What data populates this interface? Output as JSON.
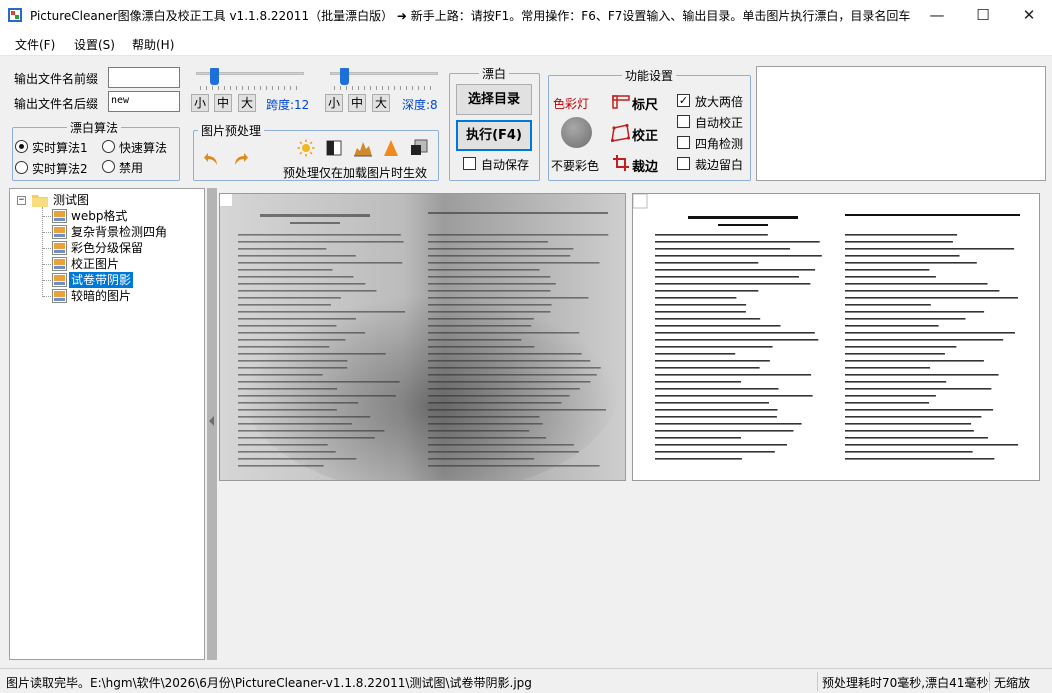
{
  "window": {
    "title": "PictureCleaner图像漂白及校正工具 v1.1.8.22011（批量漂白版）  ➜ 新手上路：请按F1。常用操作：F6、F7设置输入、输出目录。单击图片执行漂白，目录名回车...",
    "minimize": "—",
    "maximize": "☐",
    "close": "✕"
  },
  "menu": {
    "items": [
      "文件(F)",
      "设置(S)",
      "帮助(H)"
    ]
  },
  "output": {
    "prefix_label": "输出文件名前缀",
    "prefix_value": "",
    "suffix_label": "输出文件名后缀",
    "suffix_value": "new"
  },
  "span_slider": {
    "sizes": [
      "小",
      "中",
      "大"
    ],
    "value_text": "跨度:12",
    "level": 0.12
  },
  "depth_slider": {
    "sizes": [
      "小",
      "中",
      "大"
    ],
    "value_text": "深度:8",
    "level": 0.08
  },
  "algorithm": {
    "title": "漂白算法",
    "options": [
      {
        "label": "实时算法1",
        "selected": true
      },
      {
        "label": "快速算法",
        "selected": false
      },
      {
        "label": "实时算法2",
        "selected": false
      },
      {
        "label": "禁用",
        "selected": false
      }
    ]
  },
  "preprocess": {
    "title": "图片预处理",
    "note": "预处理仅在加载图片时生效",
    "icons": [
      "undo-icon",
      "redo-icon",
      "brightness-icon",
      "contrast-icon",
      "levels-icon",
      "sharpen-icon",
      "crop-icon"
    ]
  },
  "bleach": {
    "title": "漂白",
    "select_dir_label": "选择目录",
    "execute_label": "执行(F4)",
    "autosave_label": "自动保存",
    "autosave_checked": false
  },
  "functions": {
    "title": "功能设置",
    "color_lamp_label": "色彩灯",
    "no_color_label": "不要彩色",
    "ruler_label": "标尺",
    "correct_label": "校正",
    "crop_label": "裁边",
    "options": [
      {
        "label": "放大两倍",
        "checked": true
      },
      {
        "label": "自动校正",
        "checked": false
      },
      {
        "label": "四角检测",
        "checked": false
      },
      {
        "label": "裁边留白",
        "checked": false
      }
    ],
    "lamp_color": "#808080"
  },
  "tree": {
    "root": "测试图",
    "items": [
      {
        "label": "webp格式",
        "selected": false
      },
      {
        "label": "复杂背景检测四角",
        "selected": false
      },
      {
        "label": "彩色分级保留",
        "selected": false
      },
      {
        "label": "校正图片",
        "selected": false
      },
      {
        "label": "试卷带阴影",
        "selected": true
      },
      {
        "label": "较暗的图片",
        "selected": false
      }
    ]
  },
  "status": {
    "message": "图片读取完毕。E:\\hgm\\软件\\2026\\6月份\\PictureCleaner-v1.1.8.22011\\测试图\\试卷带阴影.jpg",
    "timing": "预处理耗时70毫秒,漂白41毫秒",
    "zoom": "无缩放"
  },
  "colors": {
    "accent": "#0078d7",
    "value_blue": "#0046d5",
    "lamp_red": "#c00000"
  }
}
